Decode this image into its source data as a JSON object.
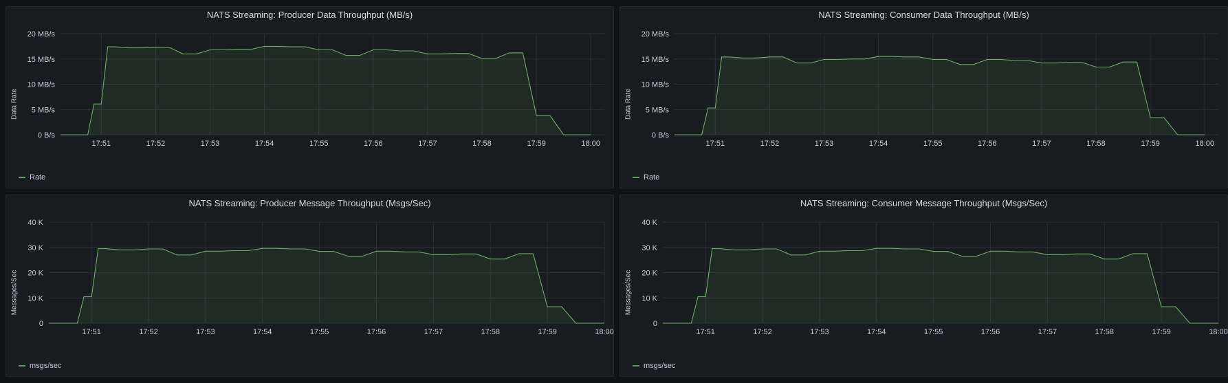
{
  "colors": {
    "background": "#111217",
    "panel": "#181b1f",
    "series_line": "#73bf69",
    "grid": "#2c3036"
  },
  "chart_data": [
    {
      "type": "area",
      "title": "NATS Streaming: Producer Data Throughput (MB/s)",
      "xlabel": "",
      "ylabel": "Data Rate",
      "x_ticks": [
        "17:51",
        "17:52",
        "17:53",
        "17:54",
        "17:55",
        "17:56",
        "17:57",
        "17:58",
        "17:59",
        "18:00"
      ],
      "y_ticks": [
        "0 B/s",
        "5 MB/s",
        "10 MB/s",
        "15 MB/s",
        "20 MB/s"
      ],
      "y_tick_values": [
        0,
        5,
        10,
        15,
        20
      ],
      "ylim": [
        0,
        20
      ],
      "x_range": [
        "17:50:15",
        "18:00:15"
      ],
      "legend": "bottom-left",
      "grid": true,
      "series": [
        {
          "name": "Rate",
          "x": [
            "17:50:15",
            "17:50:30",
            "17:50:45",
            "17:50:52",
            "17:51:00",
            "17:51:07",
            "17:51:15",
            "17:51:30",
            "17:51:45",
            "17:52:00",
            "17:52:15",
            "17:52:30",
            "17:52:45",
            "17:53:00",
            "17:53:15",
            "17:53:30",
            "17:53:45",
            "17:54:00",
            "17:54:15",
            "17:54:30",
            "17:54:45",
            "17:55:00",
            "17:55:15",
            "17:55:30",
            "17:55:45",
            "17:56:00",
            "17:56:15",
            "17:56:30",
            "17:56:45",
            "17:57:00",
            "17:57:15",
            "17:57:30",
            "17:57:45",
            "17:58:00",
            "17:58:15",
            "17:58:30",
            "17:58:45",
            "17:59:00",
            "17:59:15",
            "17:59:30",
            "17:59:45",
            "18:00:00"
          ],
          "values": [
            0,
            0,
            0,
            6.1,
            6.1,
            17.4,
            17.4,
            17.2,
            17.2,
            17.3,
            17.3,
            16.0,
            16.0,
            16.8,
            16.8,
            16.9,
            16.9,
            17.5,
            17.5,
            17.4,
            17.4,
            16.8,
            16.8,
            15.7,
            15.7,
            16.8,
            16.8,
            16.6,
            16.6,
            16.0,
            16.0,
            16.1,
            16.1,
            15.1,
            15.1,
            16.2,
            16.2,
            3.8,
            3.8,
            0,
            0,
            0
          ]
        }
      ]
    },
    {
      "type": "area",
      "title": "NATS Streaming: Consumer Data Throughput (MB/s)",
      "xlabel": "",
      "ylabel": "Data Rate",
      "x_ticks": [
        "17:51",
        "17:52",
        "17:53",
        "17:54",
        "17:55",
        "17:56",
        "17:57",
        "17:58",
        "17:59",
        "18:00"
      ],
      "y_ticks": [
        "0 B/s",
        "5 MB/s",
        "10 MB/s",
        "15 MB/s",
        "20 MB/s"
      ],
      "y_tick_values": [
        0,
        5,
        10,
        15,
        20
      ],
      "ylim": [
        0,
        20
      ],
      "x_range": [
        "17:50:15",
        "18:00:15"
      ],
      "legend": "bottom-left",
      "grid": true,
      "series": [
        {
          "name": "Rate",
          "x": [
            "17:50:15",
            "17:50:30",
            "17:50:45",
            "17:50:52",
            "17:51:00",
            "17:51:07",
            "17:51:15",
            "17:51:30",
            "17:51:45",
            "17:52:00",
            "17:52:15",
            "17:52:30",
            "17:52:45",
            "17:53:00",
            "17:53:15",
            "17:53:30",
            "17:53:45",
            "17:54:00",
            "17:54:15",
            "17:54:30",
            "17:54:45",
            "17:55:00",
            "17:55:15",
            "17:55:30",
            "17:55:45",
            "17:56:00",
            "17:56:15",
            "17:56:30",
            "17:56:45",
            "17:57:00",
            "17:57:15",
            "17:57:30",
            "17:57:45",
            "17:58:00",
            "17:58:15",
            "17:58:30",
            "17:58:45",
            "17:59:00",
            "17:59:15",
            "17:59:30",
            "17:59:45",
            "18:00:00"
          ],
          "values": [
            0,
            0,
            0,
            5.3,
            5.3,
            15.4,
            15.4,
            15.2,
            15.2,
            15.4,
            15.4,
            14.2,
            14.2,
            14.9,
            14.9,
            15.0,
            15.0,
            15.5,
            15.5,
            15.4,
            15.4,
            14.9,
            14.9,
            13.9,
            13.9,
            14.9,
            14.9,
            14.7,
            14.7,
            14.2,
            14.2,
            14.3,
            14.3,
            13.4,
            13.4,
            14.4,
            14.4,
            3.4,
            3.4,
            0,
            0,
            0
          ]
        }
      ]
    },
    {
      "type": "area",
      "title": "NATS Streaming: Producer Message Throughput (Msgs/Sec)",
      "xlabel": "",
      "ylabel": "Messages/Sec",
      "x_ticks": [
        "17:51",
        "17:52",
        "17:53",
        "17:54",
        "17:55",
        "17:56",
        "17:57",
        "17:58",
        "17:59",
        "18:00"
      ],
      "y_ticks": [
        "0",
        "10 K",
        "20 K",
        "30 K",
        "40 K"
      ],
      "y_tick_values": [
        0,
        10000,
        20000,
        30000,
        40000
      ],
      "ylim": [
        0,
        40000
      ],
      "x_range": [
        "17:50:15",
        "18:00:00"
      ],
      "legend": "bottom-left",
      "grid": true,
      "series": [
        {
          "name": "msgs/sec",
          "x": [
            "17:50:15",
            "17:50:30",
            "17:50:45",
            "17:50:52",
            "17:51:00",
            "17:51:07",
            "17:51:15",
            "17:51:30",
            "17:51:45",
            "17:52:00",
            "17:52:15",
            "17:52:30",
            "17:52:45",
            "17:53:00",
            "17:53:15",
            "17:53:30",
            "17:53:45",
            "17:54:00",
            "17:54:15",
            "17:54:30",
            "17:54:45",
            "17:55:00",
            "17:55:15",
            "17:55:30",
            "17:55:45",
            "17:56:00",
            "17:56:15",
            "17:56:30",
            "17:56:45",
            "17:57:00",
            "17:57:15",
            "17:57:30",
            "17:57:45",
            "17:58:00",
            "17:58:15",
            "17:58:30",
            "17:58:45",
            "17:59:00",
            "17:59:15",
            "17:59:30",
            "17:59:45",
            "18:00:00"
          ],
          "values": [
            0,
            0,
            0,
            10500,
            10500,
            29500,
            29500,
            29000,
            29000,
            29400,
            29400,
            27000,
            27000,
            28500,
            28500,
            28700,
            28700,
            29600,
            29600,
            29400,
            29400,
            28400,
            28400,
            26500,
            26500,
            28500,
            28500,
            28200,
            28200,
            27100,
            27100,
            27400,
            27400,
            25400,
            25400,
            27500,
            27500,
            6500,
            6500,
            0,
            0,
            0
          ]
        }
      ]
    },
    {
      "type": "area",
      "title": "NATS Streaming: Consumer Message Throughput (Msgs/Sec)",
      "xlabel": "",
      "ylabel": "Messages/Sec",
      "x_ticks": [
        "17:51",
        "17:52",
        "17:53",
        "17:54",
        "17:55",
        "17:56",
        "17:57",
        "17:58",
        "17:59",
        "18:00"
      ],
      "y_ticks": [
        "0",
        "10 K",
        "20 K",
        "30 K",
        "40 K"
      ],
      "y_tick_values": [
        0,
        10000,
        20000,
        30000,
        40000
      ],
      "ylim": [
        0,
        40000
      ],
      "x_range": [
        "17:50:15",
        "18:00:00"
      ],
      "legend": "bottom-left",
      "grid": true,
      "series": [
        {
          "name": "msgs/sec",
          "x": [
            "17:50:15",
            "17:50:30",
            "17:50:45",
            "17:50:52",
            "17:51:00",
            "17:51:07",
            "17:51:15",
            "17:51:30",
            "17:51:45",
            "17:52:00",
            "17:52:15",
            "17:52:30",
            "17:52:45",
            "17:53:00",
            "17:53:15",
            "17:53:30",
            "17:53:45",
            "17:54:00",
            "17:54:15",
            "17:54:30",
            "17:54:45",
            "17:55:00",
            "17:55:15",
            "17:55:30",
            "17:55:45",
            "17:56:00",
            "17:56:15",
            "17:56:30",
            "17:56:45",
            "17:57:00",
            "17:57:15",
            "17:57:30",
            "17:57:45",
            "17:58:00",
            "17:58:15",
            "17:58:30",
            "17:58:45",
            "17:59:00",
            "17:59:15",
            "17:59:30",
            "17:59:45",
            "18:00:00"
          ],
          "values": [
            0,
            0,
            0,
            10500,
            10500,
            29500,
            29500,
            29000,
            29000,
            29400,
            29400,
            27000,
            27000,
            28500,
            28500,
            28700,
            28700,
            29600,
            29600,
            29400,
            29400,
            28400,
            28400,
            26500,
            26500,
            28500,
            28500,
            28200,
            28200,
            27100,
            27100,
            27400,
            27400,
            25400,
            25400,
            27500,
            27500,
            6500,
            6500,
            0,
            0,
            0
          ]
        }
      ]
    }
  ]
}
